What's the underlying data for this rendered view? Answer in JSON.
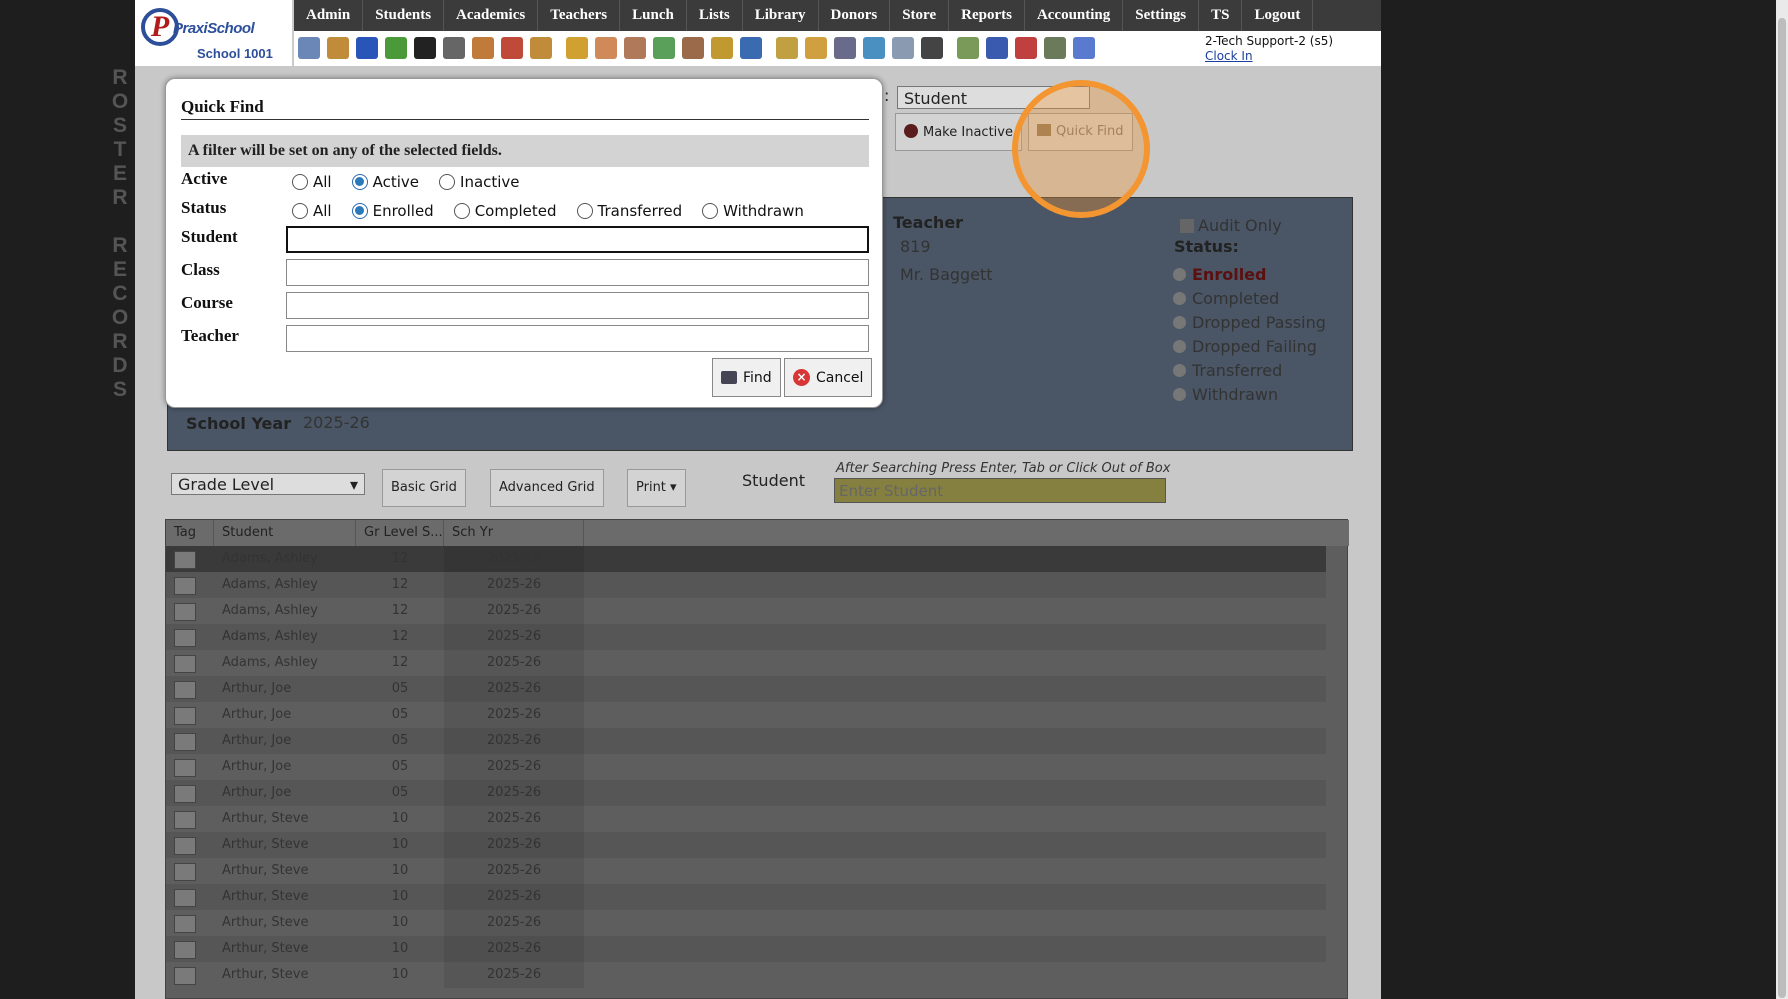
{
  "logo": {
    "brand": "PraxiSchool",
    "school": "School 1001"
  },
  "menu": [
    "Admin",
    "Students",
    "Academics",
    "Teachers",
    "Lunch",
    "Lists",
    "Library",
    "Donors",
    "Store",
    "Reports",
    "Accounting",
    "Settings",
    "TS",
    "Logout"
  ],
  "user": {
    "name": "2-Tech Support-2 (s5)",
    "clock": "Clock In"
  },
  "sidebar_vertical": [
    "R",
    "O",
    "S",
    "T",
    "E",
    "R",
    "",
    "R",
    "E",
    "C",
    "O",
    "R",
    "D",
    "S"
  ],
  "background": {
    "select_value": "Student",
    "make_inactive": "Make Inactive",
    "quick_find": "Quick Find",
    "teacher_label": "Teacher",
    "teacher_id": "819",
    "teacher_name": "Mr. Baggett",
    "audit_only": "Audit Only",
    "status_label": "Status:",
    "status_options": [
      "Enrolled",
      "Completed",
      "Dropped Passing",
      "Dropped Failing",
      "Transferred",
      "Withdrawn"
    ],
    "school_year_label": "School Year",
    "school_year_value": "2025-26",
    "grade_level": "Grade Level",
    "basic_grid": "Basic Grid",
    "advanced_grid": "Advanced Grid",
    "print": "Print",
    "student_label": "Student",
    "search_hint": "After Searching Press Enter, Tab or Click Out of Box",
    "search_placeholder": "Enter  Student"
  },
  "grid": {
    "columns": [
      "Tag",
      "Student",
      "Gr Level S...",
      "Sch Yr"
    ],
    "rows": [
      [
        "Adams, Ashley",
        "12",
        "2025-26"
      ],
      [
        "Adams, Ashley",
        "12",
        "2025-26"
      ],
      [
        "Adams, Ashley",
        "12",
        "2025-26"
      ],
      [
        "Adams, Ashley",
        "12",
        "2025-26"
      ],
      [
        "Adams, Ashley",
        "12",
        "2025-26"
      ],
      [
        "Arthur, Joe",
        "05",
        "2025-26"
      ],
      [
        "Arthur, Joe",
        "05",
        "2025-26"
      ],
      [
        "Arthur, Joe",
        "05",
        "2025-26"
      ],
      [
        "Arthur, Joe",
        "05",
        "2025-26"
      ],
      [
        "Arthur, Joe",
        "05",
        "2025-26"
      ],
      [
        "Arthur, Steve",
        "10",
        "2025-26"
      ],
      [
        "Arthur, Steve",
        "10",
        "2025-26"
      ],
      [
        "Arthur, Steve",
        "10",
        "2025-26"
      ],
      [
        "Arthur, Steve",
        "10",
        "2025-26"
      ],
      [
        "Arthur, Steve",
        "10",
        "2025-26"
      ],
      [
        "Arthur, Steve",
        "10",
        "2025-26"
      ],
      [
        "Arthur, Steve",
        "10",
        "2025-26"
      ]
    ]
  },
  "modal": {
    "title": "Quick Find",
    "info": "A filter will be set on any of the selected fields.",
    "active_label": "Active",
    "active_options": [
      {
        "label": "All",
        "checked": false
      },
      {
        "label": "Active",
        "checked": true
      },
      {
        "label": "Inactive",
        "checked": false
      }
    ],
    "status_label": "Status",
    "status_options": [
      {
        "label": "All",
        "checked": false
      },
      {
        "label": "Enrolled",
        "checked": true
      },
      {
        "label": "Completed",
        "checked": false
      },
      {
        "label": "Transferred",
        "checked": false
      },
      {
        "label": "Withdrawn",
        "checked": false
      }
    ],
    "student_label": "Student",
    "student_value": "",
    "class_label": "Class",
    "class_value": "",
    "course_label": "Course",
    "course_value": "",
    "teacher_label": "Teacher",
    "teacher_value": "",
    "find_label": "Find",
    "cancel_label": "Cancel"
  },
  "colors": {
    "accent": "#2d4f9a",
    "highlight": "#f39530",
    "menubar": "#3b3b3b"
  }
}
